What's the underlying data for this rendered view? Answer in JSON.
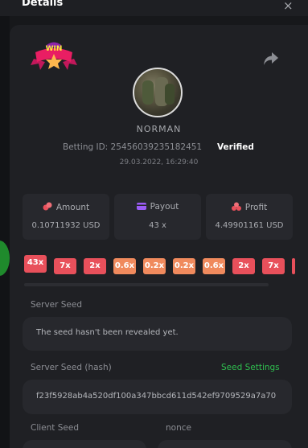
{
  "modal": {
    "title": "Details",
    "close_glyph": "×"
  },
  "player": {
    "name": "NORMAN",
    "betting_id_label": "Betting ID:",
    "betting_id": "25456039235182451",
    "verified": "Verified",
    "timestamp": "29.03.2022, 16:29:40"
  },
  "stats": [
    {
      "label": "Amount",
      "value": "0.10711932 USD",
      "icon": "coins-icon",
      "color": "#e8505b"
    },
    {
      "label": "Payout",
      "value": "43 x",
      "icon": "wallet-icon",
      "color": "#9b5cf6"
    },
    {
      "label": "Profit",
      "value": "4.49901161 USD",
      "icon": "coin-stack-icon",
      "color": "#e8505b"
    }
  ],
  "history": [
    {
      "label": "43x",
      "color": "red"
    },
    {
      "label": "7x",
      "color": "red"
    },
    {
      "label": "2x",
      "color": "red"
    },
    {
      "label": "0.6x",
      "color": "orange"
    },
    {
      "label": "0.2x",
      "color": "orange"
    },
    {
      "label": "0.2x",
      "color": "orange"
    },
    {
      "label": "0.6x",
      "color": "orange"
    },
    {
      "label": "2x",
      "color": "red"
    },
    {
      "label": "7x",
      "color": "red"
    }
  ],
  "server_seed": {
    "label": "Server Seed",
    "value": "The seed hasn't been revealed yet."
  },
  "server_seed_hash": {
    "label": "Server Seed (hash)",
    "settings_label": "Seed Settings",
    "value": "f23f5928ab4a520df100a347bbcd611d542ef9709529a7a70"
  },
  "client_seed": {
    "label": "Client Seed"
  },
  "nonce": {
    "label": "nonce"
  },
  "colors": {
    "accent_green": "#2fbf4f",
    "red_chip": "#e8505b",
    "orange_chip": "#f08a5d",
    "panel": "#1f2024",
    "card": "#27282d"
  }
}
